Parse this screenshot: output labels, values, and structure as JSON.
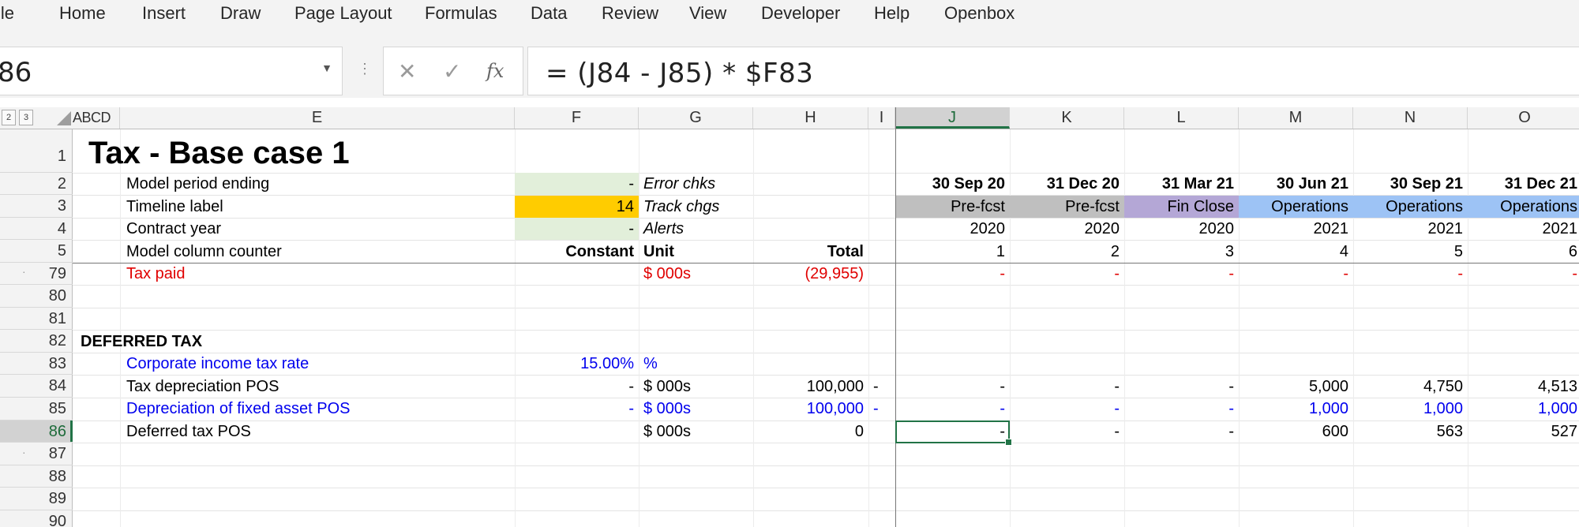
{
  "menu": [
    "ile",
    "Home",
    "Insert",
    "Draw",
    "Page Layout",
    "Formulas",
    "Data",
    "Review",
    "View",
    "Developer",
    "Help",
    "Openbox"
  ],
  "name_box": "86",
  "formula_buttons": {
    "cancel": "✕",
    "enter": "✓",
    "fx": "fx"
  },
  "formula": "= (J84 - J85) * $F83",
  "outline_levels": [
    "2",
    "3"
  ],
  "outline_col_label": "ABCD",
  "columns": [
    "E",
    "F",
    "G",
    "H",
    "I",
    "J",
    "K",
    "L",
    "M",
    "N",
    "O"
  ],
  "selected_column": "J",
  "rows": [
    "1",
    "2",
    "3",
    "4",
    "5",
    "79",
    "80",
    "81",
    "82",
    "83",
    "84",
    "85",
    "86",
    "87",
    "88",
    "89",
    "90"
  ],
  "selected_row": "86",
  "colors": {
    "input_green": "#e2efda",
    "timeline_orange": "#ffcc00",
    "prefcst_gray": "#bfbfbf",
    "finclose_purple": "#b4a7d6",
    "operations_blue": "#9dc3f5",
    "selection_green": "#217346"
  },
  "sheet": {
    "title": "Tax - Base case 1",
    "r2": {
      "label": "Model period ending",
      "f": "-",
      "g": "Error chks",
      "dates": [
        "30 Sep 20",
        "31 Dec 20",
        "31 Mar 21",
        "30 Jun 21",
        "30 Sep 21",
        "31 Dec 21"
      ]
    },
    "r3": {
      "label": "Timeline label",
      "f": "14",
      "g": "Track chgs",
      "phases": [
        "Pre-fcst",
        "Pre-fcst",
        "Fin Close",
        "Operations",
        "Operations",
        "Operations"
      ]
    },
    "r4": {
      "label": "Contract year",
      "f": "-",
      "g": "Alerts",
      "years": [
        "2020",
        "2020",
        "2020",
        "2021",
        "2021",
        "2021"
      ]
    },
    "r5": {
      "label": "Model column counter",
      "f": "Constant",
      "g": "Unit",
      "h": "Total",
      "counters": [
        "1",
        "2",
        "3",
        "4",
        "5",
        "6"
      ]
    },
    "r79": {
      "label": "Tax paid",
      "g": "$ 000s",
      "h": "(29,955)",
      "values": [
        "-",
        "-",
        "-",
        "-",
        "-",
        "-"
      ]
    },
    "r82": {
      "label": "DEFERRED TAX"
    },
    "r83": {
      "label": "Corporate income tax rate",
      "f": "15.00%",
      "g": "%"
    },
    "r84": {
      "label": "Tax depreciation POS",
      "f": "-",
      "g": "$ 000s",
      "h": "100,000",
      "i": "-",
      "values": [
        "-",
        "-",
        "-",
        "5,000",
        "4,750",
        "4,513"
      ]
    },
    "r85": {
      "label": "Depreciation of fixed asset POS",
      "f": "-",
      "g": "$ 000s",
      "h": "100,000",
      "i": "-",
      "values": [
        "-",
        "-",
        "-",
        "1,000",
        "1,000",
        "1,000"
      ]
    },
    "r86": {
      "label": "Deferred tax POS",
      "g": "$ 000s",
      "h": "0",
      "values": [
        "-",
        "-",
        "-",
        "600",
        "563",
        "527"
      ]
    }
  }
}
